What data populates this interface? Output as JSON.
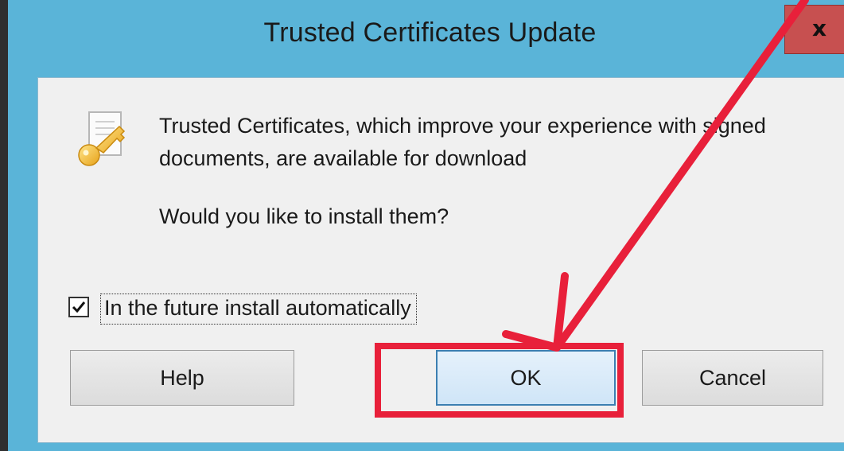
{
  "window": {
    "title": "Trusted Certificates Update",
    "close_label": "x"
  },
  "dialog": {
    "icon": "certificate-key-icon",
    "message": "Trusted Certificates, which improve your experience with signed documents, are available for download",
    "question": "Would you like to install them?",
    "auto_install": {
      "label": "In the future install automatically",
      "checked": true
    }
  },
  "buttons": {
    "help": "Help",
    "ok": "OK",
    "cancel": "Cancel"
  },
  "annotation": {
    "highlight_color": "#e8203a",
    "arrow_color": "#e8203a",
    "target": "ok-button"
  }
}
